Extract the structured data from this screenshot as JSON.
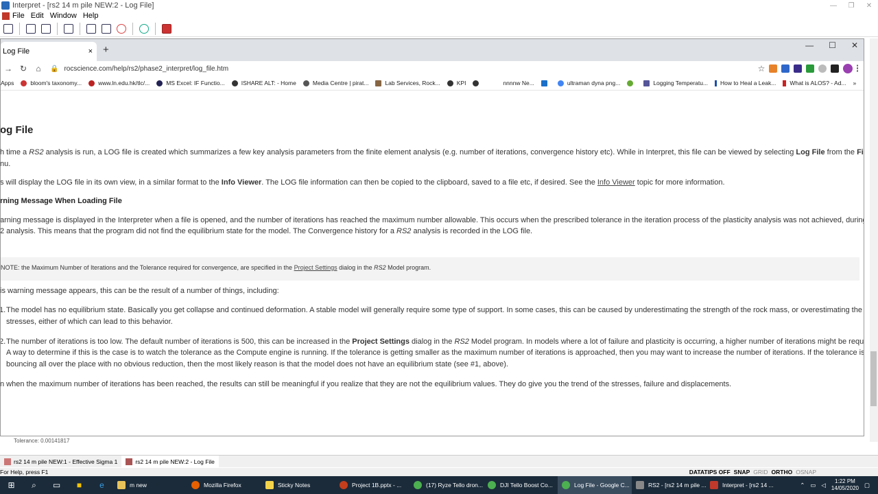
{
  "app": {
    "title": "Interpret - [rs2 14 m pile NEW:2 - Log File]",
    "menu": [
      "File",
      "Edit",
      "Window",
      "Help"
    ]
  },
  "browser": {
    "tab_title": "Log File",
    "tab_close": "×",
    "new_tab": "+",
    "url": "rocscience.com/help/rs2/phase2_interpret/log_file.htm"
  },
  "bookmarks": [
    "Apps",
    "bloom's taxonomy...",
    "www.ln.edu.hk/tlc/...",
    "MS Excel: IF Functio...",
    "ISHARE ALT: - Home",
    "Media Centre | pirat...",
    "Lab Services, Rock...",
    "KPI",
    "nnnnw Ne...",
    "ultraman dyna png...",
    "Logging Temperatu...",
    "How to Heal a Leak...",
    "What is ALOS? - Ad..."
  ],
  "page": {
    "title": "og File",
    "p1a": "h time a ",
    "p1b": "RS2",
    "p1c": " analysis is run, a LOG file is created which summarizes a few key analysis parameters from the finite element analysis (e.g. number of iterations, convergence history etc). While in Interpret, this file can be viewed by selecting ",
    "p1d": "Log File",
    "p1e": " from the ",
    "p1f": "File",
    "p1g": "nu.",
    "p2a": "s will display the LOG file in its own view, in a similar format to the ",
    "p2b": "Info Viewer",
    "p2c": ". The LOG file information can then be copied to the clipboard, saved to a file etc, if desired. See the ",
    "p2d": "Info Viewer",
    "p2e": " topic for more information.",
    "h2": "rning Message When Loading File",
    "p3": "arning message is displayed in the Interpreter when a file is opened, and the number of iterations has reached the maximum number allowable. This occurs when the prescribed tolerance in the iteration process of the plasticity analysis was not achieved, during the",
    "p3b_a": "2 analysis. This means that the program did not find the equilibrium state for the model. The Convergence history for a ",
    "p3b_b": "RS2",
    "p3b_c": " analysis is recorded in the LOG file.",
    "note_a": "NOTE: the Maximum Number of Iterations and the Tolerance required for convergence, are specified in the ",
    "note_b": "Project Settings",
    "note_c": " dialog in the ",
    "note_d": "RS2",
    "note_e": " Model program.",
    "p4": "is warning message appears, this can be the result of a number of things, including:",
    "li1_num": "1.",
    "li1a": "The model has no equilibrium state. Basically you get collapse and continued deformation. A stable model will generally require some type of support. In some cases, this can be caused by underestimating the strength of the rock mass, or overestimating the initial",
    "li1b": "stresses, either of which can lead to this behavior.",
    "li2_num": "2.",
    "li2a1": "The number of iterations is too low. The default number of iterations is 500, this can be increased in the ",
    "li2a2": "Project Settings",
    "li2a3": " dialog in the ",
    "li2a4": "RS2",
    "li2a5": " Model program. In models where a lot of failure and plasticity is occurring, a higher number of iterations might be required.",
    "li2b": "A way to determine if this is the case is to watch the tolerance as the Compute engine is running. If the tolerance is getting smaller as the maximum number of iterations is approached, then you may want to increase the number of iterations. If the tolerance is",
    "li2c": "bouncing all over the place with no obvious reduction, then the most likely reason is that the model does not have an equilibrium state (see #1, above).",
    "p5": "n when the maximum number of iterations has been reached, the results can still be meaningful if you realize that they are not the equilibrium values. They do give you the trend of the stresses, failure and displacements."
  },
  "partial_text": "Tolerance: 0.00141817",
  "mdi_tabs": [
    "rs2 14 m pile NEW:1 - Effective Sigma 1",
    "rs2 14 m pile NEW:2 - Log File"
  ],
  "status": {
    "help": "For Help, press F1",
    "datatips": "DATATIPS OFF",
    "snap": "SNAP",
    "grid": "GRID",
    "ortho": "ORTHO",
    "osnap": "OSNAP"
  },
  "taskbar": {
    "apps": [
      {
        "label": "m new",
        "color": "#e8c35a"
      },
      {
        "label": "Mozilla Firefox",
        "color": "#e66000"
      },
      {
        "label": "Sticky Notes",
        "color": "#f3d34a"
      },
      {
        "label": "Project 1B.pptx - ...",
        "color": "#c43e1c"
      },
      {
        "label": "(17) Ryze Tello dron...",
        "color": "#4caf50"
      },
      {
        "label": "DJI Tello Boost Co...",
        "color": "#4caf50"
      },
      {
        "label": "Log File - Google C...",
        "color": "#4caf50"
      },
      {
        "label": "RS2 - [rs2 14 m pile ...",
        "color": "#888"
      },
      {
        "label": "Interpret - [rs2 14 ...",
        "color": "#c0392b"
      }
    ],
    "time": "1:22 PM",
    "date": "14/05/2020"
  }
}
